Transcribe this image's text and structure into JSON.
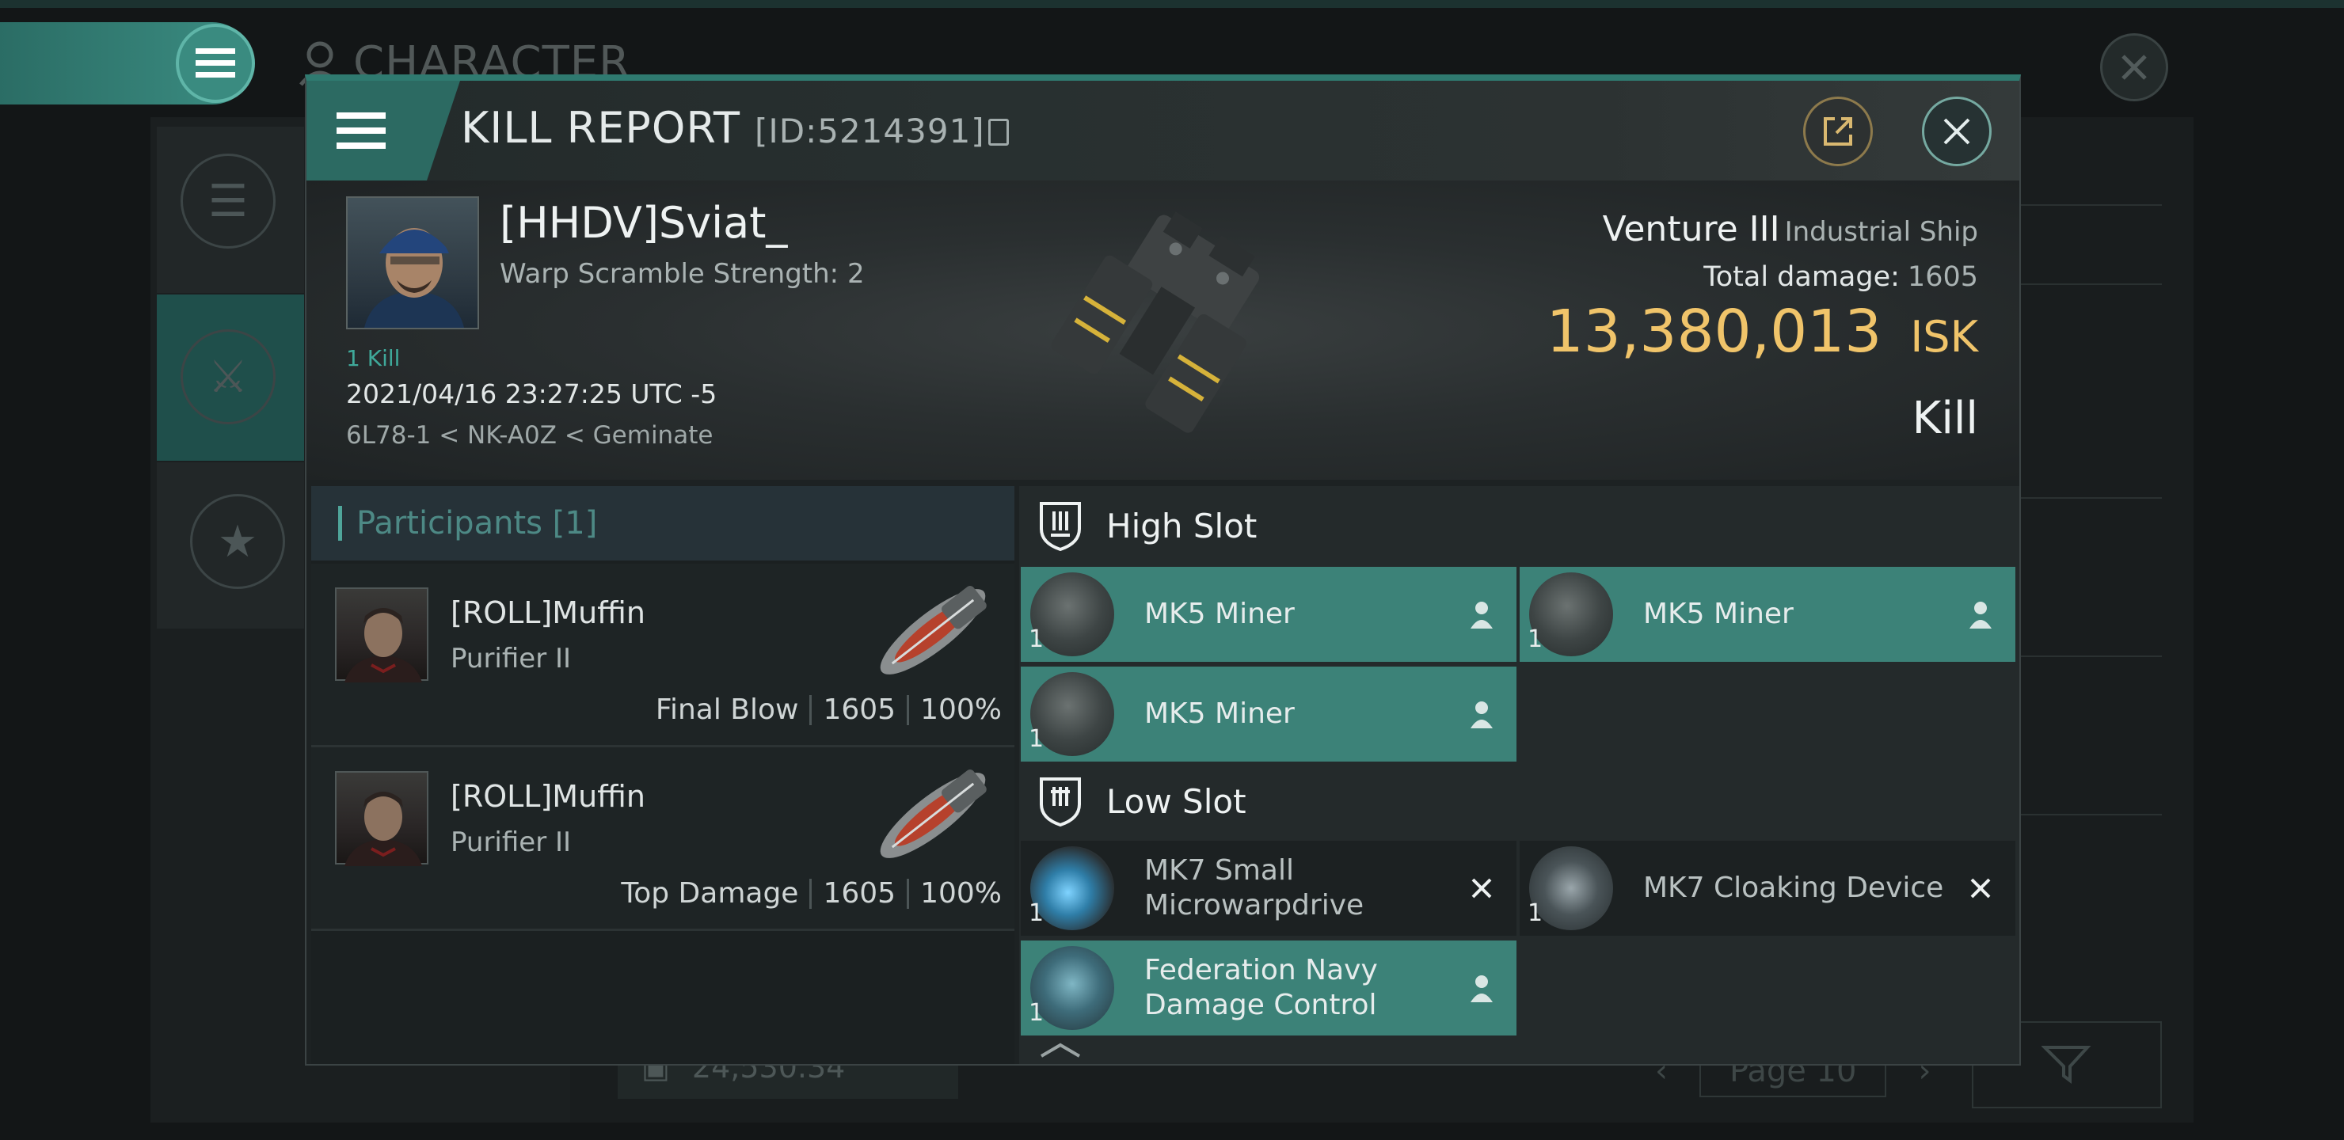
{
  "background": {
    "title": "CHARACTER",
    "footer_value": "24,530.34",
    "pagination_label": "Page 10"
  },
  "dialog": {
    "title": "KILL REPORT",
    "id_label": "[ID:5214391]",
    "victim": {
      "name": "[HHDV]Sviat_",
      "subtitle": "Warp Scramble Strength: 2",
      "kill_count": "1 Kill",
      "datetime": "2021/04/16 23:27:25 UTC -5",
      "location": "6L78-1 < NK-A0Z < Geminate"
    },
    "ship": {
      "name": "Venture III",
      "class": "Industrial Ship",
      "total_damage_label": "Total damage:",
      "total_damage": "1605",
      "isk_value": "13,380,013",
      "isk_unit": "ISK",
      "result": "Kill"
    },
    "participants": {
      "header": "Participants [1]",
      "rows": [
        {
          "name": "[ROLL]Muffin",
          "ship": "Purifier II",
          "role": "Final Blow",
          "damage": "1605",
          "percent": "100%"
        },
        {
          "name": "[ROLL]Muffin",
          "ship": "Purifier II",
          "role": "Top Damage",
          "damage": "1605",
          "percent": "100%"
        }
      ]
    },
    "fittings": {
      "high_slot_label": "High Slot",
      "low_slot_label": "Low Slot",
      "high_slot": [
        {
          "name": "MK5 Miner",
          "qty": "1",
          "status": "fitted"
        },
        {
          "name": "MK5 Miner",
          "qty": "1",
          "status": "fitted"
        },
        {
          "name": "MK5 Miner",
          "qty": "1",
          "status": "fitted"
        }
      ],
      "low_slot": [
        {
          "name_line1": "MK7 Small",
          "name_line2": "Microwarpdrive",
          "qty": "1",
          "status": "destroyed"
        },
        {
          "name_line1": "MK7 Cloaking Device",
          "name_line2": "",
          "qty": "1",
          "status": "destroyed"
        },
        {
          "name_line1": "Federation Navy",
          "name_line2": "Damage Control",
          "qty": "1",
          "status": "fitted"
        }
      ]
    }
  },
  "colors": {
    "accent_teal": "#3c8278",
    "isk_gold": "#f0c46a",
    "kill_count_green": "#3fa99a"
  },
  "icons": {
    "menu": "hamburger-icon",
    "share": "share-icon",
    "close": "close-icon",
    "copy": "copy-icon",
    "slot": "slot-shield-icon",
    "fitted": "person-icon",
    "destroyed": "x-icon"
  }
}
